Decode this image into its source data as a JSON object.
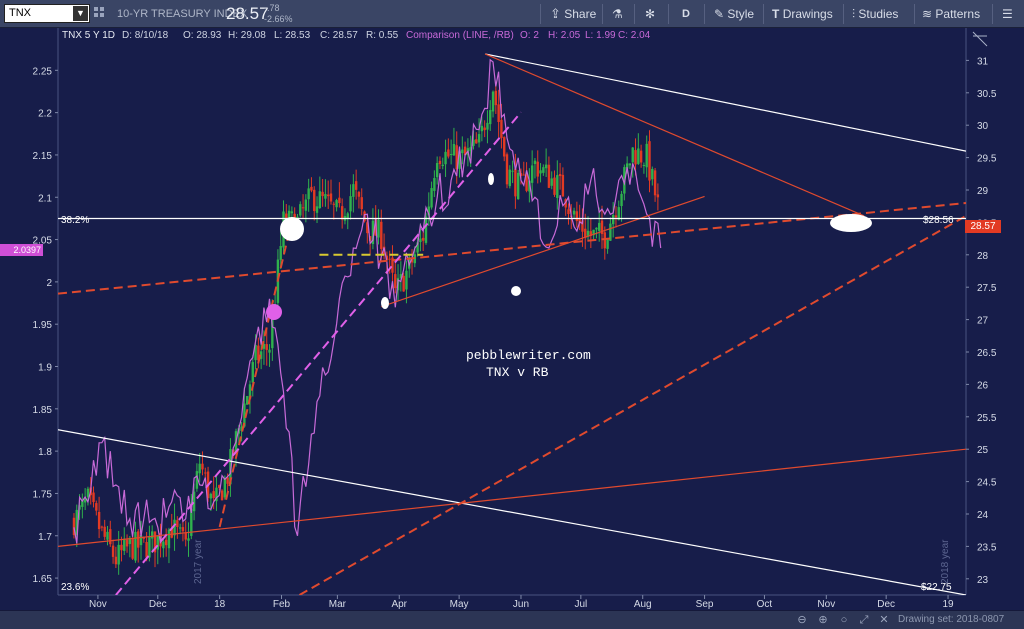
{
  "toolbar": {
    "symbol": "TNX",
    "title": "10-YR TREASURY INDEX",
    "price": "28.57",
    "change": "-.78",
    "change_pct": "-2.66%",
    "buttons": [
      {
        "key": "share",
        "label": "Share",
        "icon": "share-icon"
      },
      {
        "key": "flask",
        "label": "",
        "icon": "flask-icon"
      },
      {
        "key": "gear",
        "label": "",
        "icon": "gear-icon"
      },
      {
        "key": "period",
        "label": "D",
        "icon": ""
      },
      {
        "key": "style",
        "label": "Style",
        "icon": "style-icon"
      },
      {
        "key": "drawings",
        "label": "Drawings",
        "icon": "drawings-icon"
      },
      {
        "key": "studies",
        "label": "Studies",
        "icon": "studies-icon"
      },
      {
        "key": "patterns",
        "label": "Patterns",
        "icon": "patterns-icon"
      },
      {
        "key": "more",
        "label": "",
        "icon": "more-icon"
      }
    ]
  },
  "header_line": {
    "symbol": "TNX 5 Y 1D",
    "date": "D: 8/10/18",
    "open": "O: 28.93",
    "high": "H: 29.08",
    "low": "L: 28.53",
    "close": "C: 28.57",
    "r": "R: 0.55",
    "comparison": "Comparison (LINE, /RB)",
    "c_open": "O: 2",
    "c_high": "H: 2.05",
    "c_low": "L: 1.99",
    "c_close": "C: 2.04"
  },
  "annotations": {
    "site": "pebblewriter.com",
    "subtitle": "TNX v RB",
    "fib_382": "38.2%",
    "fib_236": "23.6%",
    "level_2856": "$28.56",
    "level_2275": "$22.75",
    "year_2017": "2017 year",
    "year_2018": "2018 year"
  },
  "tags": {
    "left_value": "2.0397",
    "right_value": "28.57"
  },
  "bottom": {
    "drawing_set": "Drawing set: 2018-0807"
  },
  "colors": {
    "background": "#171d4a",
    "up": "#2fb14d",
    "down": "#e23a23",
    "comparison": "#c86ad8",
    "trend_red": "#e04a2e",
    "trend_white": "#ffffff",
    "trend_magenta": "#e060e8",
    "trend_yellow": "#d8c930"
  },
  "chart_data": {
    "type": "candlestick",
    "x_tick_labels": [
      "Nov",
      "Dec",
      "18",
      "Feb",
      "Mar",
      "Apr",
      "May",
      "Jun",
      "Jul",
      "Aug",
      "Sep",
      "Oct",
      "Nov",
      "Dec",
      "19"
    ],
    "right_axis": {
      "label": "TNX",
      "ticks": [
        23,
        23.5,
        24,
        24.5,
        25,
        25.5,
        26,
        26.5,
        27,
        27.5,
        28,
        28.5,
        29,
        29.5,
        30,
        30.5,
        31
      ],
      "range": [
        22.75,
        31.5
      ]
    },
    "left_axis": {
      "label": "RB",
      "ticks": [
        1.65,
        1.7,
        1.75,
        1.8,
        1.85,
        1.9,
        1.95,
        2,
        2.05,
        2.1,
        2.15,
        2.2,
        2.25
      ],
      "range": [
        1.63,
        2.3
      ]
    },
    "tnx_path": [
      {
        "date": "2017-10-20",
        "v": 23.9
      },
      {
        "date": "2017-10-27",
        "v": 24.2
      },
      {
        "date": "2017-11-03",
        "v": 23.7
      },
      {
        "date": "2017-11-10",
        "v": 23.3
      },
      {
        "date": "2017-11-17",
        "v": 23.5
      },
      {
        "date": "2017-11-24",
        "v": 23.5
      },
      {
        "date": "2017-12-01",
        "v": 23.6
      },
      {
        "date": "2017-12-08",
        "v": 23.8
      },
      {
        "date": "2017-12-15",
        "v": 23.5
      },
      {
        "date": "2017-12-22",
        "v": 24.8
      },
      {
        "date": "2017-12-29",
        "v": 24.1
      },
      {
        "date": "2018-01-05",
        "v": 24.6
      },
      {
        "date": "2018-01-12",
        "v": 25.5
      },
      {
        "date": "2018-01-19",
        "v": 26.4
      },
      {
        "date": "2018-01-26",
        "v": 26.6
      },
      {
        "date": "2018-02-02",
        "v": 28.5
      },
      {
        "date": "2018-02-09",
        "v": 28.5
      },
      {
        "date": "2018-02-16",
        "v": 28.9
      },
      {
        "date": "2018-02-23",
        "v": 28.8
      },
      {
        "date": "2018-03-02",
        "v": 28.6
      },
      {
        "date": "2018-03-09",
        "v": 29.0
      },
      {
        "date": "2018-03-16",
        "v": 28.4
      },
      {
        "date": "2018-03-23",
        "v": 28.3
      },
      {
        "date": "2018-03-30",
        "v": 27.4
      },
      {
        "date": "2018-04-06",
        "v": 27.8
      },
      {
        "date": "2018-04-13",
        "v": 28.3
      },
      {
        "date": "2018-04-20",
        "v": 29.6
      },
      {
        "date": "2018-04-27",
        "v": 29.5
      },
      {
        "date": "2018-05-04",
        "v": 29.5
      },
      {
        "date": "2018-05-11",
        "v": 29.7
      },
      {
        "date": "2018-05-18",
        "v": 30.6
      },
      {
        "date": "2018-05-25",
        "v": 29.3
      },
      {
        "date": "2018-06-01",
        "v": 29.0
      },
      {
        "date": "2018-06-08",
        "v": 29.4
      },
      {
        "date": "2018-06-15",
        "v": 29.2
      },
      {
        "date": "2018-06-22",
        "v": 29.0
      },
      {
        "date": "2018-06-29",
        "v": 28.5
      },
      {
        "date": "2018-07-06",
        "v": 28.3
      },
      {
        "date": "2018-07-13",
        "v": 28.3
      },
      {
        "date": "2018-07-20",
        "v": 28.9
      },
      {
        "date": "2018-07-27",
        "v": 29.6
      },
      {
        "date": "2018-08-03",
        "v": 29.5
      },
      {
        "date": "2018-08-10",
        "v": 28.57
      }
    ],
    "rb_path": [
      {
        "date": "2017-10-20",
        "v": 1.71
      },
      {
        "date": "2017-10-27",
        "v": 1.74
      },
      {
        "date": "2017-11-03",
        "v": 1.81
      },
      {
        "date": "2017-11-10",
        "v": 1.76
      },
      {
        "date": "2017-11-17",
        "v": 1.72
      },
      {
        "date": "2017-11-24",
        "v": 1.72
      },
      {
        "date": "2017-12-01",
        "v": 1.71
      },
      {
        "date": "2017-12-08",
        "v": 1.74
      },
      {
        "date": "2017-12-15",
        "v": 1.72
      },
      {
        "date": "2017-12-22",
        "v": 1.76
      },
      {
        "date": "2017-12-29",
        "v": 1.74
      },
      {
        "date": "2018-01-05",
        "v": 1.77
      },
      {
        "date": "2018-01-12",
        "v": 1.84
      },
      {
        "date": "2018-01-19",
        "v": 1.93
      },
      {
        "date": "2018-01-26",
        "v": 1.98
      },
      {
        "date": "2018-02-02",
        "v": 1.87
      },
      {
        "date": "2018-02-09",
        "v": 1.7
      },
      {
        "date": "2018-02-16",
        "v": 1.82
      },
      {
        "date": "2018-02-23",
        "v": 1.89
      },
      {
        "date": "2018-03-02",
        "v": 1.98
      },
      {
        "date": "2018-03-09",
        "v": 2.04
      },
      {
        "date": "2018-03-16",
        "v": 2.08
      },
      {
        "date": "2018-03-23",
        "v": 2.03
      },
      {
        "date": "2018-03-30",
        "v": 1.97
      },
      {
        "date": "2018-04-06",
        "v": 2.02
      },
      {
        "date": "2018-04-13",
        "v": 2.06
      },
      {
        "date": "2018-04-20",
        "v": 2.1
      },
      {
        "date": "2018-04-27",
        "v": 2.12
      },
      {
        "date": "2018-05-04",
        "v": 2.15
      },
      {
        "date": "2018-05-11",
        "v": 2.18
      },
      {
        "date": "2018-05-18",
        "v": 2.26
      },
      {
        "date": "2018-05-25",
        "v": 2.17
      },
      {
        "date": "2018-06-01",
        "v": 2.12
      },
      {
        "date": "2018-06-08",
        "v": 2.1
      },
      {
        "date": "2018-06-15",
        "v": 2.04
      },
      {
        "date": "2018-06-22",
        "v": 2.09
      },
      {
        "date": "2018-06-29",
        "v": 2.06
      },
      {
        "date": "2018-07-06",
        "v": 2.12
      },
      {
        "date": "2018-07-13",
        "v": 2.08
      },
      {
        "date": "2018-07-20",
        "v": 2.12
      },
      {
        "date": "2018-07-27",
        "v": 2.14
      },
      {
        "date": "2018-08-03",
        "v": 2.08
      },
      {
        "date": "2018-08-10",
        "v": 2.04
      }
    ],
    "trend_lines": [
      {
        "name": "white-upper",
        "color": "white",
        "dashed": false,
        "from": {
          "date": "2018-05-14",
          "v": 31.1
        },
        "to": {
          "date": "2019-01-10",
          "v": 29.6
        }
      },
      {
        "name": "white-lower",
        "color": "white",
        "dashed": false,
        "from": {
          "date": "2017-10-12",
          "v": 25.3
        },
        "to": {
          "date": "2019-01-10",
          "v": 22.75
        }
      },
      {
        "name": "red-upper",
        "color": "red",
        "dashed": false,
        "from": {
          "date": "2018-05-14",
          "v": 31.1
        },
        "to": {
          "date": "2018-11-20",
          "v": 28.6
        }
      },
      {
        "name": "red-mid",
        "color": "red",
        "dashed": false,
        "from": {
          "date": "2018-03-23",
          "v": 27.2
        },
        "to": {
          "date": "2018-09-01",
          "v": 28.9
        }
      },
      {
        "name": "red-long",
        "color": "red",
        "dashed": false,
        "from": {
          "date": "2017-10-12",
          "v": 23.5
        },
        "to": {
          "date": "2019-01-10",
          "v": 25.0
        }
      },
      {
        "name": "red-dash-long",
        "color": "red",
        "dashed": true,
        "from": {
          "date": "2017-10-12",
          "v": 27.4
        },
        "to": {
          "date": "2019-01-10",
          "v": 28.8
        }
      },
      {
        "name": "red-dash-steep",
        "color": "red",
        "dashed": true,
        "from": {
          "date": "2018-02-10",
          "v": 22.75
        },
        "to": {
          "date": "2019-01-10",
          "v": 28.6
        }
      },
      {
        "name": "red-dash-early",
        "color": "red",
        "dashed": true,
        "from": {
          "date": "2018-01-01",
          "v": 23.8
        },
        "to": {
          "date": "2018-02-06",
          "v": 28.5
        }
      },
      {
        "name": "magenta-dash",
        "color": "magenta",
        "dashed": true,
        "from": {
          "date": "2017-11-10",
          "v": 22.75
        },
        "to": {
          "date": "2018-06-01",
          "v": 30.2
        }
      },
      {
        "name": "yellow-dash",
        "color": "yellow",
        "dashed": true,
        "from": {
          "date": "2018-02-20",
          "v": 28.0
        },
        "to": {
          "date": "2018-04-13",
          "v": 28.0
        }
      },
      {
        "name": "level-2856",
        "color": "white",
        "dashed": false,
        "from": {
          "date": "2017-10-12",
          "v": 28.56
        },
        "to": {
          "date": "2019-01-10",
          "v": 28.56
        }
      }
    ]
  }
}
